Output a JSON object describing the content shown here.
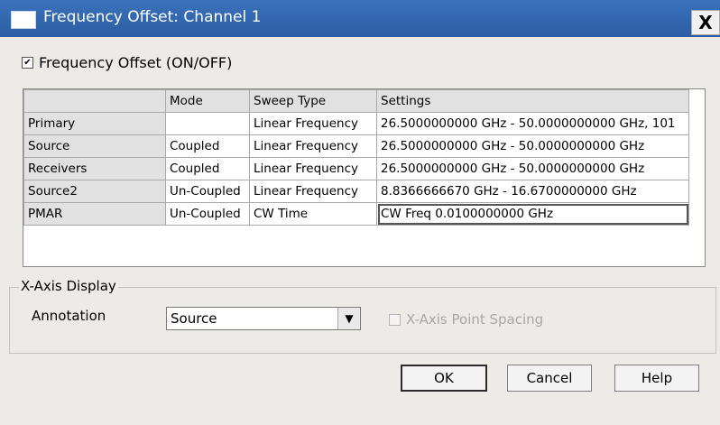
{
  "window": {
    "title": "Frequency Offset: Channel 1",
    "close_glyph": "X"
  },
  "frequency_offset": {
    "label": "Frequency Offset (ON/OFF)",
    "checked": true,
    "check_glyph": "✔"
  },
  "grid": {
    "headers": [
      "",
      "Mode",
      "Sweep Type",
      "Settings"
    ],
    "rows": [
      {
        "name": "Primary",
        "mode": "",
        "sweep": "Linear Frequency",
        "settings": "26.5000000000 GHz - 50.0000000000 GHz, 101"
      },
      {
        "name": "Source",
        "mode": "Coupled",
        "sweep": "Linear Frequency",
        "settings": "26.5000000000 GHz - 50.0000000000 GHz"
      },
      {
        "name": "Receivers",
        "mode": "Coupled",
        "sweep": "Linear Frequency",
        "settings": "26.5000000000 GHz - 50.0000000000 GHz"
      },
      {
        "name": "Source2",
        "mode": "Un-Coupled",
        "sweep": "Linear Frequency",
        "settings": "8.8366666670 GHz - 16.6700000000 GHz"
      },
      {
        "name": "PMAR",
        "mode": "Un-Coupled",
        "sweep": "CW Time",
        "settings": "CW Freq 0.0100000000 GHz"
      }
    ]
  },
  "x_axis": {
    "legend": "X-Axis Display",
    "annotation_label": "Annotation",
    "annotation_value": "Source",
    "point_spacing_label": "X-Axis Point Spacing",
    "point_spacing_enabled": false
  },
  "buttons": {
    "ok": "OK",
    "cancel": "Cancel",
    "help": "Help"
  }
}
